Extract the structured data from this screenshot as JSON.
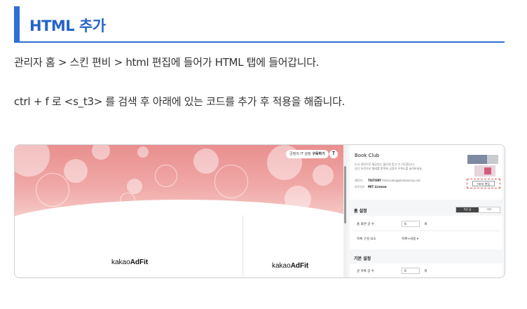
{
  "heading": "HTML 추가",
  "paragraphs": [
    "관리자 홈 > 스킨 편비 > html 편집에 들어가 HTML 탭에 들어갑니다.",
    "ctrl + f 로 <s_t3> 를 검색 후 아래에 있는 코드를 추가 후 적용을 해줍니다."
  ],
  "screenshot": {
    "preview": {
      "pill_text": "긍정의 IT 설정",
      "pill_subscribe": "구독하기",
      "badge": "T",
      "ad_brand_left_1": "kakao",
      "ad_brand_left_2": "AdFit",
      "ad_brand_right_1": "kakao",
      "ad_brand_right_2": "AdFit"
    },
    "panel": {
      "blog_name": "Book Club",
      "description_line1": "도서 관련으로 제공하는 블린센 참고 가 가진합니다.",
      "description_line2": "상단 프로모션 형태를 항목에 긍정조 우측도를 늘려보세요.",
      "author_label": "제작자",
      "author_value": "TISTORY",
      "author_email": "tistory.blog@kakaocorp.net",
      "license_label": "라이선스",
      "license_value": "MIT License",
      "edit_button": "html 편집",
      "home_settings_title": "홈 설정",
      "toggle_on": "최신 글",
      "toggle_off": "커버",
      "posts_label": "홈 화면 글 수",
      "posts_value": "6",
      "posts_unit": "개",
      "list_type_label": "목록 구성 요소",
      "list_type_value": "목록+내용 ▾",
      "basic_settings_title": "기본 설정",
      "basic_posts_label": "글 목록 글 수",
      "basic_posts_value": "6",
      "basic_posts_unit": "개"
    }
  }
}
